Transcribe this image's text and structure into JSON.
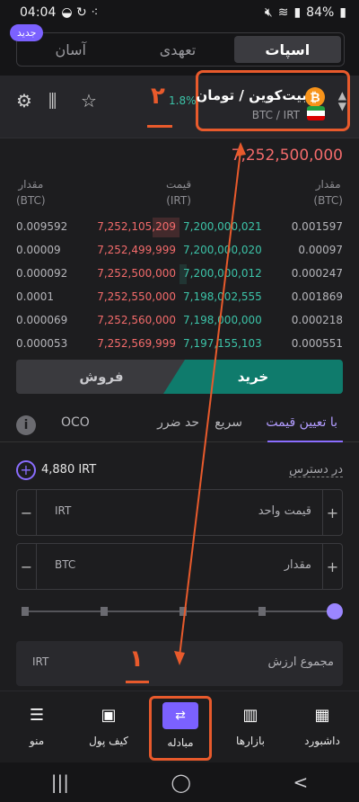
{
  "status_bar": {
    "time": "04:04",
    "battery": "84%"
  },
  "mode_tabs": [
    {
      "label": "اسپات",
      "active": true
    },
    {
      "label": "تعهدی",
      "active": false
    },
    {
      "label": "آسان",
      "active": false
    }
  ],
  "new_badge": "جدید",
  "pair": {
    "name": "بیت‌کوین / تومان",
    "symbol": "BTC / IRT",
    "change": "1.8%",
    "annotation": "۲"
  },
  "last_price": "7,252,500,000",
  "orderbook": {
    "headers": {
      "amount_left": "مقدار",
      "amount_left_unit": "(BTC)",
      "price": "قیمت",
      "price_unit": "(IRT)",
      "amount_right": "مقدار",
      "amount_right_unit": "(BTC)"
    },
    "rows": [
      {
        "sell_amount": "0.009592",
        "sell_price": "7,252,105,209",
        "buy_price": "7,200,000,021",
        "buy_amount": "0.001597"
      },
      {
        "sell_amount": "0.00009",
        "sell_price": "7,252,499,999",
        "buy_price": "7,200,000,020",
        "buy_amount": "0.00097"
      },
      {
        "sell_amount": "0.000092",
        "sell_price": "7,252,500,000",
        "buy_price": "7,200,000,012",
        "buy_amount": "0.000247"
      },
      {
        "sell_amount": "0.0001",
        "sell_price": "7,252,550,000",
        "buy_price": "7,198,002,555",
        "buy_amount": "0.001869"
      },
      {
        "sell_amount": "0.000069",
        "sell_price": "7,252,560,000",
        "buy_price": "7,198,000,000",
        "buy_amount": "0.000218"
      },
      {
        "sell_amount": "0.000053",
        "sell_price": "7,252,569,999",
        "buy_price": "7,197,155,103",
        "buy_amount": "0.000551"
      }
    ]
  },
  "trade": {
    "buy_label": "خرید",
    "sell_label": "فروش"
  },
  "order_types": [
    {
      "label": "با تعیین قیمت",
      "active": true
    },
    {
      "label": "سریع",
      "active": false
    },
    {
      "label": "حد ضرر",
      "active": false
    },
    {
      "label": "OCO",
      "active": false
    }
  ],
  "available": {
    "label": "در دسترس",
    "value": "4,880 IRT"
  },
  "price_field": {
    "label": "قیمت واحد",
    "unit": "IRT"
  },
  "amount_field": {
    "label": "مقدار",
    "unit": "BTC"
  },
  "total_field": {
    "label": "مجموع ارزش",
    "unit": "IRT",
    "annotation": "۱"
  },
  "bottom_nav": [
    {
      "label": "داشبورد",
      "icon": "dashboard-icon"
    },
    {
      "label": "بازارها",
      "icon": "markets-icon"
    },
    {
      "label": "مبادله",
      "icon": "exchange-icon"
    },
    {
      "label": "کیف پول",
      "icon": "wallet-icon"
    },
    {
      "label": "منو",
      "icon": "menu-icon"
    }
  ],
  "colors": {
    "accent": "#7b61ff",
    "buy": "#3cc3a8",
    "sell": "#f36b6b",
    "annotation": "#e85a2c"
  }
}
